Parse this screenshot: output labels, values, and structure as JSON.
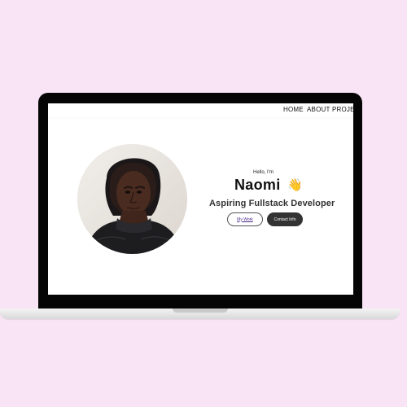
{
  "nav": {
    "items": [
      {
        "label": "HOME"
      },
      {
        "label": "ABOUT"
      },
      {
        "label": "PROJEC"
      }
    ]
  },
  "hero": {
    "greeting": "Hello, I'm",
    "name": "Naomi",
    "wave_emoji": "👋",
    "role": "Aspiring Fullstack Developer",
    "buttons": {
      "work": "My Work",
      "contact": "Contact Info"
    }
  },
  "colors": {
    "background": "#f8e4f5",
    "laptop_frame": "#050505",
    "screen": "#ffffff",
    "accent_button_dark": "#333333",
    "link_purple": "#4b2a8a"
  },
  "icons": {
    "wave": "waving-hand-icon"
  }
}
